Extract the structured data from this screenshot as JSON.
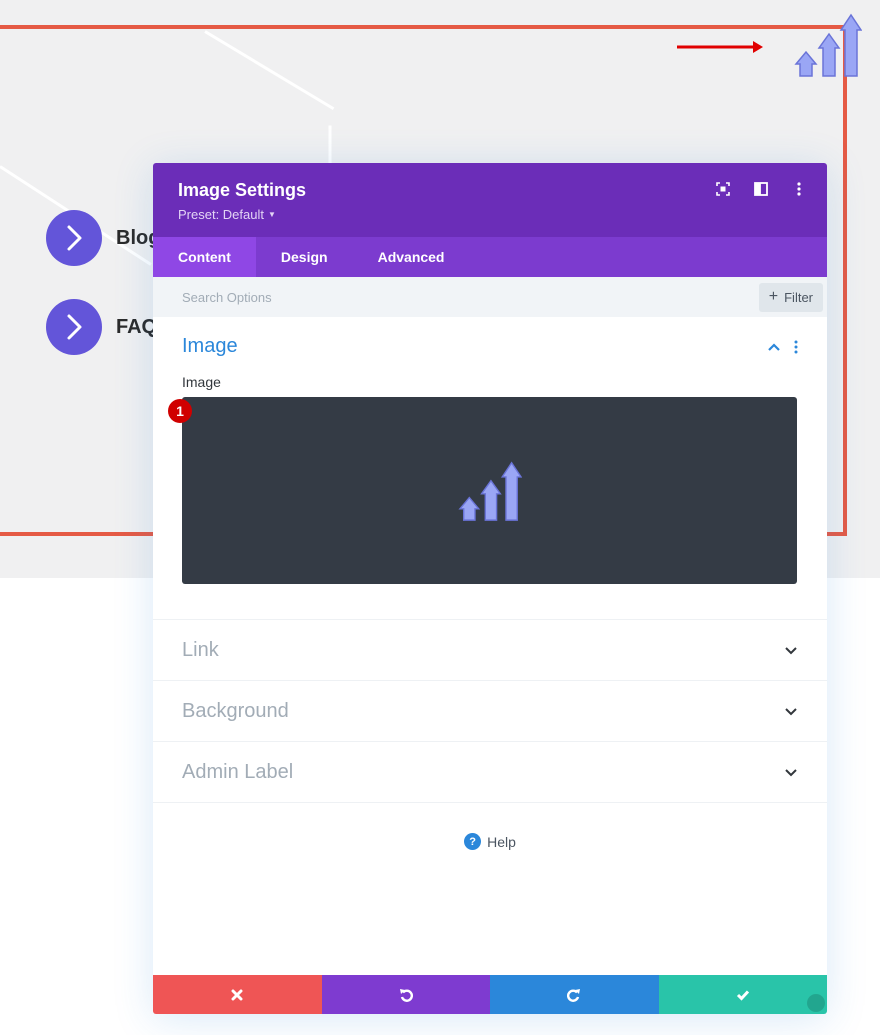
{
  "page": {
    "menu_items": [
      {
        "label": "Blog"
      },
      {
        "label": "FAQ"
      }
    ]
  },
  "modal": {
    "title": "Image Settings",
    "preset_label": "Preset: Default",
    "header_icons": [
      "focus-mode-icon",
      "split-view-icon",
      "more-options-icon"
    ],
    "tabs": [
      {
        "label": "Content",
        "active": true
      },
      {
        "label": "Design",
        "active": false
      },
      {
        "label": "Advanced",
        "active": false
      }
    ],
    "search": {
      "placeholder": "Search Options",
      "value": ""
    },
    "filter_label": "Filter",
    "sections": {
      "image": {
        "title": "Image",
        "field_label": "Image",
        "badge": "1",
        "expanded": true
      },
      "link": {
        "title": "Link"
      },
      "background": {
        "title": "Background"
      },
      "admin_label": {
        "title": "Admin Label"
      }
    },
    "help_label": "Help",
    "footer_buttons": [
      {
        "name": "discard",
        "color": "#ef5555"
      },
      {
        "name": "undo",
        "color": "#7e3bd0"
      },
      {
        "name": "redo",
        "color": "#2b87da"
      },
      {
        "name": "save",
        "color": "#29c4a9"
      }
    ]
  },
  "colors": {
    "header_purple": "#6b2db8",
    "tab_purple": "#7c3bcf",
    "active_tab": "#8f47e5",
    "accent_blue": "#2b87da",
    "frame_red": "#e55a45",
    "menu_circle": "#6355d9",
    "arrow_fill": "#9aa6f5"
  }
}
